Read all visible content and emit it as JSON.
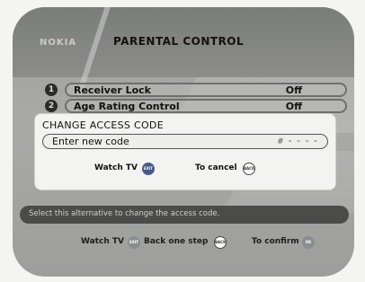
{
  "header": {
    "brand": "NOKIA",
    "title": "PARENTAL CONTROL"
  },
  "menu": {
    "items": [
      {
        "number": "1",
        "label": "Receiver Lock",
        "value": "Off"
      },
      {
        "number": "2",
        "label": "Age Rating Control",
        "value": "Off"
      }
    ]
  },
  "dialog": {
    "title": "CHANGE ACCESS CODE",
    "field_label": "Enter new code",
    "field_value": "- - - -",
    "hint_watch_tv": "Watch TV",
    "hint_cancel": "To cancel",
    "exit_btn": "EXIT",
    "back_btn": "BACK"
  },
  "status": {
    "text": "Select this alternative to change the access code."
  },
  "footer": {
    "watch_tv": "Watch TV",
    "back_one_step": "Back one step",
    "to_confirm": "To confirm",
    "exit_btn": "EXIT",
    "back_btn": "BACK",
    "ok_btn": "OK"
  }
}
